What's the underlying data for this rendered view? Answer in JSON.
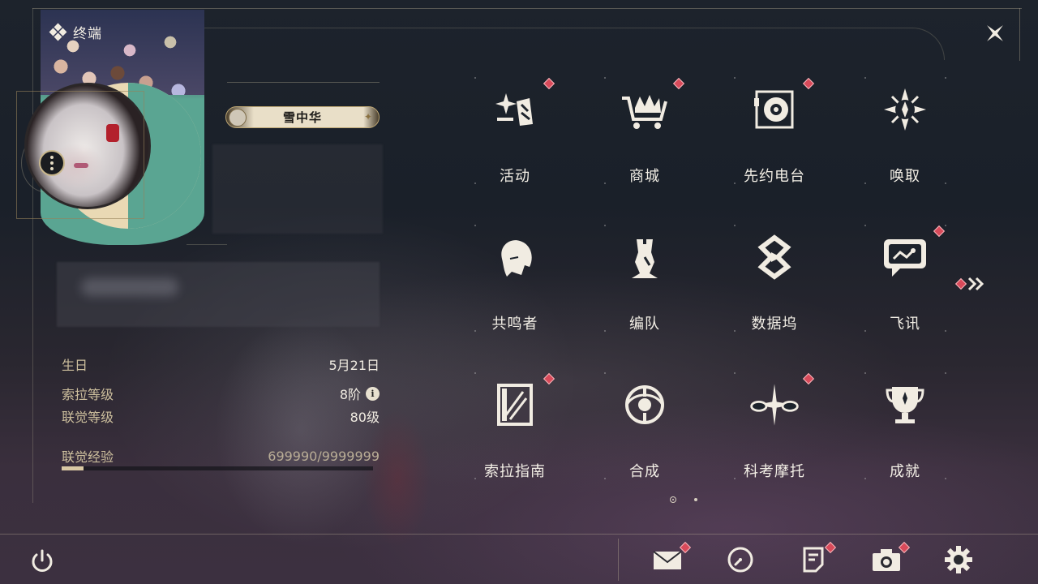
{
  "header": {
    "title": "终端",
    "title_icon": "four-diamond-icon",
    "close_icon": "close-icon"
  },
  "profile": {
    "name": "雪中华",
    "more_icon": "more-vertical-icon",
    "stats": [
      {
        "label": "生日",
        "value": "5月21日"
      },
      {
        "label": "索拉等级",
        "value": "8阶"
      },
      {
        "label": "联觉等级",
        "value": "80级"
      },
      {
        "label": "联觉经验",
        "value": "699990/9999999"
      }
    ],
    "info_icon": "i",
    "exp_progress": 0.07
  },
  "menu": {
    "items": [
      {
        "label": "活动",
        "icon": "sparkle-book-icon",
        "badge": true
      },
      {
        "label": "商城",
        "icon": "shopping-cart-icon",
        "badge": true
      },
      {
        "label": "先约电台",
        "icon": "turntable-icon",
        "badge": true
      },
      {
        "label": "唤取",
        "icon": "compass-star-icon",
        "badge": false
      },
      {
        "label": "共鸣者",
        "icon": "character-head-icon",
        "badge": false
      },
      {
        "label": "编队",
        "icon": "chess-pieces-icon",
        "badge": false
      },
      {
        "label": "数据坞",
        "icon": "data-dock-icon",
        "badge": false
      },
      {
        "label": "飞讯",
        "icon": "chat-bubble-icon",
        "badge": true
      },
      {
        "label": "索拉指南",
        "icon": "guide-book-icon",
        "badge": true
      },
      {
        "label": "合成",
        "icon": "synthesis-icon",
        "badge": false
      },
      {
        "label": "科考摩托",
        "icon": "motorbike-icon",
        "badge": true
      },
      {
        "label": "成就",
        "icon": "trophy-icon",
        "badge": false
      }
    ],
    "next_page_icon": "double-chevron-right-icon",
    "pages": 2,
    "current_page": 1
  },
  "bottom_bar": {
    "left": "power-icon",
    "right": [
      "mail-icon",
      "clock-icon",
      "notice-icon",
      "camera-icon",
      "settings-gear-icon"
    ]
  },
  "colors": {
    "accent_gold": "#cdbf9d",
    "badge_red": "#d84a5a",
    "card_teal": "#5aa592"
  }
}
